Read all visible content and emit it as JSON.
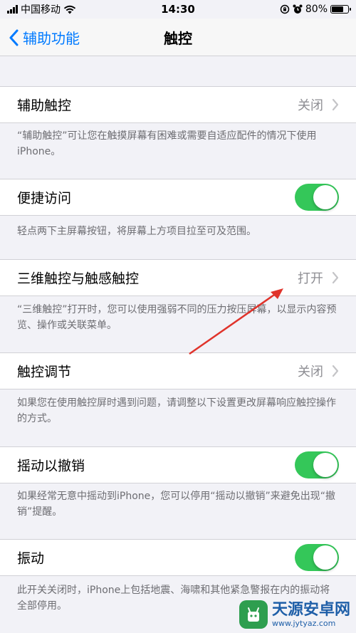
{
  "status_bar": {
    "carrier": "中国移动",
    "time": "14:30",
    "battery": "80%",
    "battery_level": 0.8
  },
  "nav": {
    "back_label": "辅助功能",
    "title": "触控"
  },
  "rows": [
    {
      "label": "辅助触控",
      "value": "关闭",
      "type": "link",
      "note": "“辅助触控”可让您在触摸屏幕有困难或需要自适应配件的情况下使用 iPhone。"
    },
    {
      "label": "便捷访问",
      "type": "toggle",
      "on": true,
      "note": "轻点两下主屏幕按钮，将屏幕上方项目拉至可及范围。"
    },
    {
      "label": "三维触控与触感触控",
      "value": "打开",
      "type": "link",
      "note": "“三维触控”打开时，您可以使用强弱不同的压力按压屏幕，以显示内容预览、操作或关联菜单。"
    },
    {
      "label": "触控调节",
      "value": "关闭",
      "type": "link",
      "note": "如果您在使用触控屏时遇到问题，请调整以下设置更改屏幕响应触控操作的方式。"
    },
    {
      "label": "摇动以撤销",
      "type": "toggle",
      "on": true,
      "note": "如果经常无意中摇动到iPhone，您可以停用“摇动以撤销”来避免出现“撤销”提醒。"
    },
    {
      "label": "振动",
      "type": "toggle",
      "on": true,
      "note": "此开关关闭时，iPhone上包括地震、海啸和其他紧急警报在内的振动将全部停用。"
    }
  ],
  "watermark": {
    "title": "天源安卓网",
    "url": "www.jytyaz.com"
  },
  "colors": {
    "accent": "#007aff",
    "toggle_on": "#34c759",
    "annotation_arrow": "#e0332b"
  }
}
